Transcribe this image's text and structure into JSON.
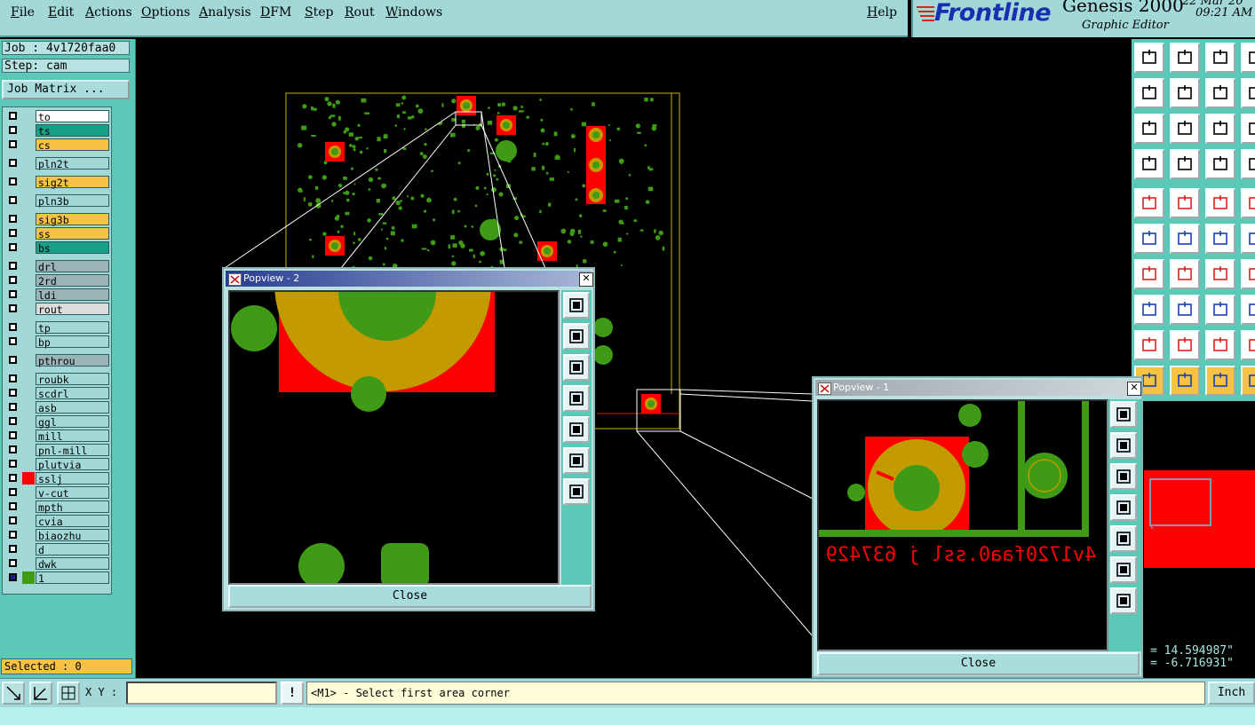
{
  "menu": [
    "File",
    "Edit",
    "Actions",
    "Options",
    "Analysis",
    "DFM",
    "Step",
    "Rout",
    "Windows"
  ],
  "help": "Help",
  "brand": {
    "logo": "Frontline",
    "product": "Genesis 2000",
    "date": "22 Mar 20",
    "time": "09:21 AM",
    "subtitle": "Graphic Editor"
  },
  "job": {
    "job_line": "Job : 4v1720faa0",
    "step_line": "Step: cam",
    "matrix_button": "Job Matrix ..."
  },
  "layers": [
    {
      "name": "to",
      "bg": "#ffffff"
    },
    {
      "name": "ts",
      "bg": "#1aa088"
    },
    {
      "name": "cs",
      "bg": "#f5c244"
    },
    {
      "name": "pln2t",
      "bg": "#a3d8d8"
    },
    {
      "name": "sig2t",
      "bg": "#f5c244"
    },
    {
      "name": "pln3b",
      "bg": "#a3d8d8"
    },
    {
      "name": "sig3b",
      "bg": "#f5c244"
    },
    {
      "name": "ss",
      "bg": "#f5c244"
    },
    {
      "name": "bs",
      "bg": "#1aa088"
    },
    {
      "name": "drl",
      "bg": "#9ab4b8"
    },
    {
      "name": "2rd",
      "bg": "#9ab4b8"
    },
    {
      "name": "ldi",
      "bg": "#9ab4b8"
    },
    {
      "name": "rout",
      "bg": "#dcdcdc"
    },
    {
      "name": "tp",
      "bg": "#a3d8d8"
    },
    {
      "name": "bp",
      "bg": "#a3d8d8"
    },
    {
      "name": "pthrou",
      "bg": "#9ab4b8"
    },
    {
      "name": "roubk",
      "bg": "#a3d8d8"
    },
    {
      "name": "scdrl",
      "bg": "#a3d8d8"
    },
    {
      "name": "asb",
      "bg": "#a3d8d8"
    },
    {
      "name": "ggl",
      "bg": "#a3d8d8"
    },
    {
      "name": "mill",
      "bg": "#a3d8d8"
    },
    {
      "name": "pnl-mill",
      "bg": "#a3d8d8"
    },
    {
      "name": "plutvia",
      "bg": "#a3d8d8"
    },
    {
      "name": "sslj",
      "bg": "#a3d8d8"
    },
    {
      "name": "v-cut",
      "bg": "#a3d8d8"
    },
    {
      "name": "mpth",
      "bg": "#a3d8d8"
    },
    {
      "name": "cvia",
      "bg": "#a3d8d8"
    },
    {
      "name": "biaozhu",
      "bg": "#a3d8d8"
    },
    {
      "name": "d",
      "bg": "#a3d8d8"
    },
    {
      "name": "dwk",
      "bg": "#a3d8d8"
    },
    {
      "name": "1",
      "bg": "#a3d8d8"
    }
  ],
  "selected": "Selected : 0",
  "popview2": {
    "title": "Popview - 2",
    "close": "Close"
  },
  "popview1": {
    "title": "Popview - 1",
    "close": "Close",
    "silk_text": "4v1720faa0.ssl j 637429"
  },
  "coords": {
    "x": "= 14.594987\"",
    "y": "= -6.716931\""
  },
  "status": {
    "xy_label": "X Y :",
    "xy_value": "",
    "prompt": "<M1> - Select first area corner",
    "units": "Inch",
    "bang": "!"
  },
  "colors": {
    "panel": "#a3d8d8",
    "accent": "#5bc8b8",
    "copper": "#3f9a16",
    "pad": "#ff0000",
    "ring": "#c39a00"
  }
}
